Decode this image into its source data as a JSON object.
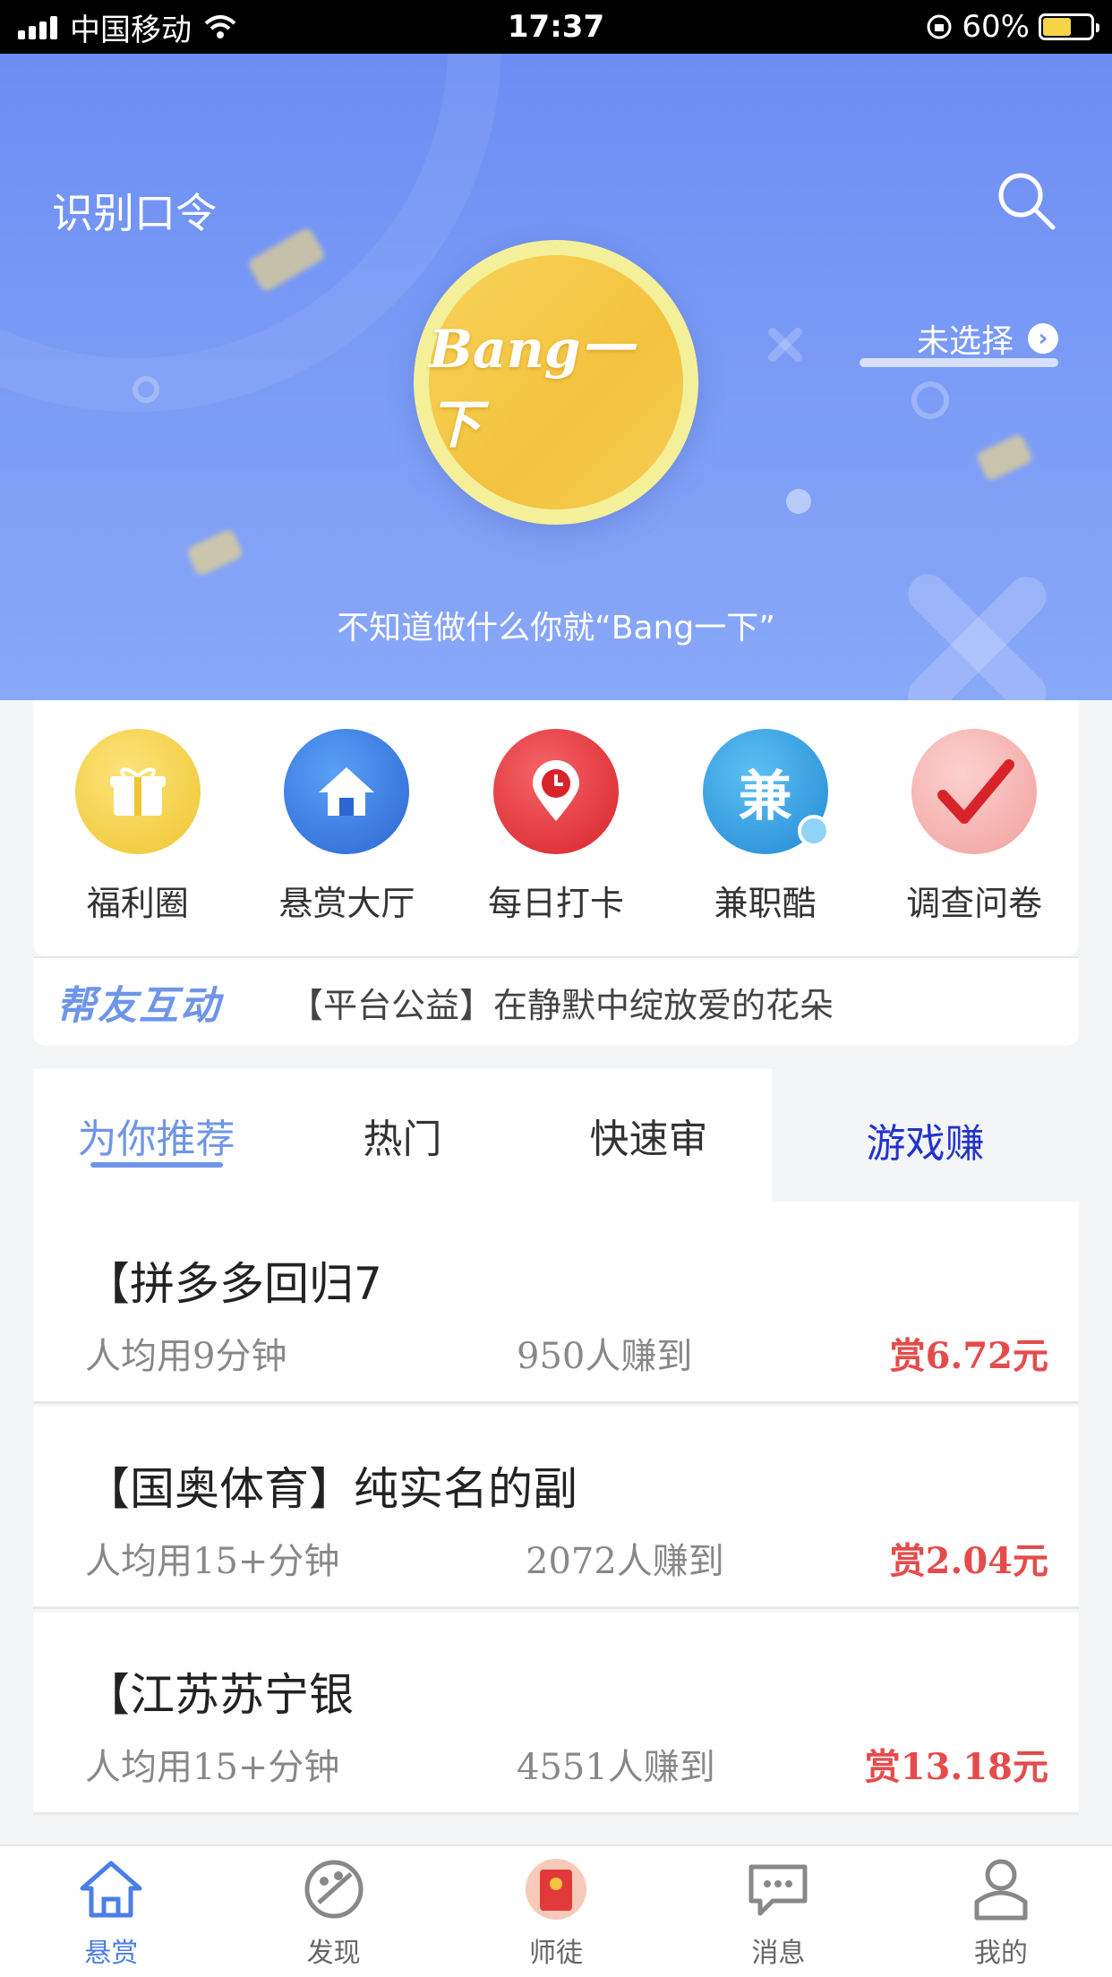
{
  "status_bar": {
    "carrier": "中国移动",
    "time": "17:37",
    "battery": "60%",
    "battery_level": 0.6
  },
  "hero": {
    "scan_label": "识别口令",
    "select_label": "未选择",
    "coin_text": "Bang一下",
    "subtitle": "不知道做什么你就“Bang一下”"
  },
  "entries": [
    {
      "label": "福利圈",
      "icon": "gift-icon",
      "color": "#f5d247"
    },
    {
      "label": "悬赏大厅",
      "icon": "house-icon",
      "color": "#3d7de5"
    },
    {
      "label": "每日打卡",
      "icon": "clock-pin-icon",
      "color": "#e8393f"
    },
    {
      "label": "兼职酷",
      "icon": "jian-badge-icon",
      "glyph": "兼",
      "color": "#3aa5e8"
    },
    {
      "label": "调查问卷",
      "icon": "checkmark-icon",
      "color": "#f4b3b1"
    }
  ],
  "notice": {
    "brand": "帮友互动",
    "text": "【平台公益】在静默中绽放爱的花朵"
  },
  "tabs": [
    {
      "label": "为你推荐"
    },
    {
      "label": "热门"
    },
    {
      "label": "快速审"
    },
    {
      "label": "游戏赚"
    }
  ],
  "tasks": [
    {
      "title": "【拼多多回归7",
      "time": "人均用9分钟",
      "count": "950人赚到",
      "reward": "赏6.72元"
    },
    {
      "title": "【国奥体育】纯实名的副",
      "time": "人均用15+分钟",
      "count": "2072人赚到",
      "reward": "赏2.04元"
    },
    {
      "title": "【江苏苏宁银",
      "time": "人均用15+分钟",
      "count": "4551人赚到",
      "reward": "赏13.18元"
    }
  ],
  "bottom_nav": [
    {
      "label": "悬赏",
      "icon": "home-icon"
    },
    {
      "label": "发现",
      "icon": "palette-icon"
    },
    {
      "label": "师徒",
      "icon": "red-envelope-icon"
    },
    {
      "label": "消息",
      "icon": "chat-icon"
    },
    {
      "label": "我的",
      "icon": "profile-icon"
    }
  ],
  "colors": {
    "accent": "#6e95e8",
    "reward": "#e54b4b",
    "game_tab": "#2233cc"
  }
}
